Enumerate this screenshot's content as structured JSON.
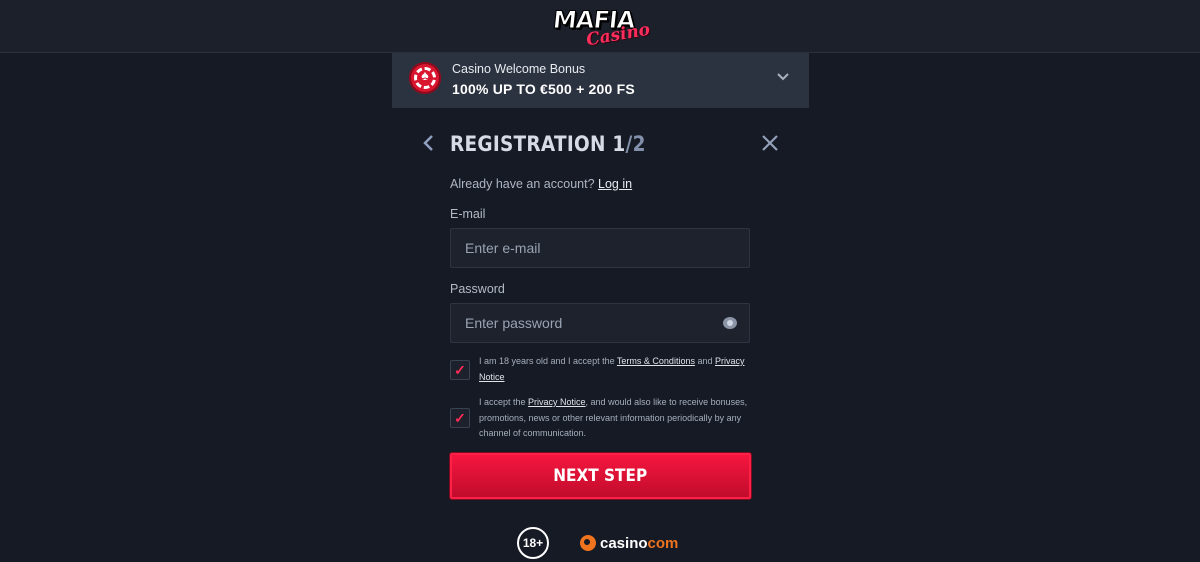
{
  "header": {
    "logo_word": "MAFIA",
    "logo_script": "Casino"
  },
  "bonus": {
    "title": "Casino Welcome Bonus",
    "offer": "100% UP TO €500 + 200 FS",
    "chip_icon": "poker-chip-icon",
    "chevron_icon": "chevron-down-icon"
  },
  "registration": {
    "title_prefix": "REGISTRATION 1",
    "title_total": "/2",
    "already_text": "Already have an account?",
    "login_link": "Log in",
    "email_label": "E-mail",
    "email_placeholder": "Enter e-mail",
    "password_label": "Password",
    "password_placeholder": "Enter password",
    "terms": {
      "text_before": "I am 18 years old and I accept the ",
      "terms_link": "Terms & Conditions",
      "text_and": " and ",
      "privacy_link": "Privacy Notice",
      "checked": true
    },
    "marketing": {
      "text_before": "I accept the ",
      "privacy_link": "Privacy Notice",
      "text_after": ", and would also like to receive bonuses, promotions, news or other relevant information periodically by any channel of communication.",
      "checked": true
    },
    "next_label": "NEXT STEP"
  },
  "footer": {
    "age_badge": "18+",
    "brand_left": "casino",
    "brand_right": "com"
  },
  "colors": {
    "accent": "#f6163f",
    "background": "#151a25",
    "brand_orange": "#f0731e"
  }
}
